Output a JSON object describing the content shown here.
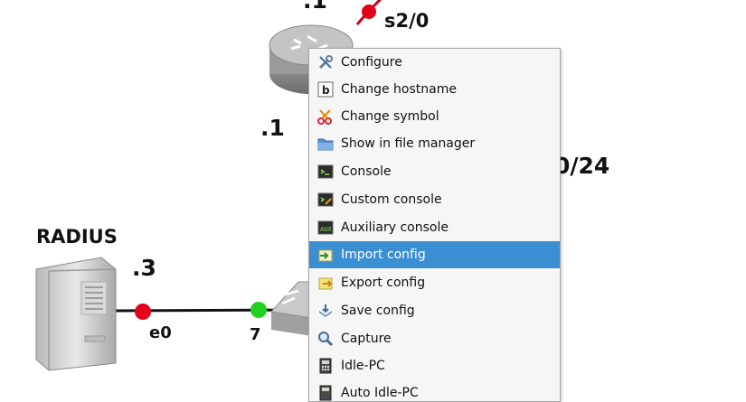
{
  "topology": {
    "router_top_label": ".1",
    "router_interface_top": "s2/0",
    "router_label_left": ".1",
    "subnet_label": "0/24",
    "server_name": "RADIUS",
    "server_ip": ".3",
    "server_interface": "e0",
    "switch_port": "7",
    "colors": {
      "link_down": "#e3001b",
      "link_up": "#22d022"
    }
  },
  "context_menu": {
    "items": [
      {
        "label": "Configure",
        "icon": "wrench-screwdriver-icon"
      },
      {
        "label": "Change hostname",
        "icon": "text-b-icon"
      },
      {
        "label": "Change symbol",
        "icon": "scissors-icon"
      },
      {
        "label": "Show in file manager",
        "icon": "folder-icon"
      },
      {
        "label": "Console",
        "icon": "terminal-icon"
      },
      {
        "label": "Custom console",
        "icon": "custom-terminal-icon"
      },
      {
        "label": "Auxiliary console",
        "icon": "aux-terminal-icon"
      },
      {
        "label": "Import config",
        "icon": "import-icon",
        "selected": true
      },
      {
        "label": "Export config",
        "icon": "export-icon"
      },
      {
        "label": "Save config",
        "icon": "save-icon"
      },
      {
        "label": "Capture",
        "icon": "magnifier-icon"
      },
      {
        "label": "Idle-PC",
        "icon": "calculator-icon"
      },
      {
        "label": "Auto Idle-PC",
        "icon": "auto-calculator-icon"
      }
    ],
    "selected_color": "#3a8fd3"
  }
}
